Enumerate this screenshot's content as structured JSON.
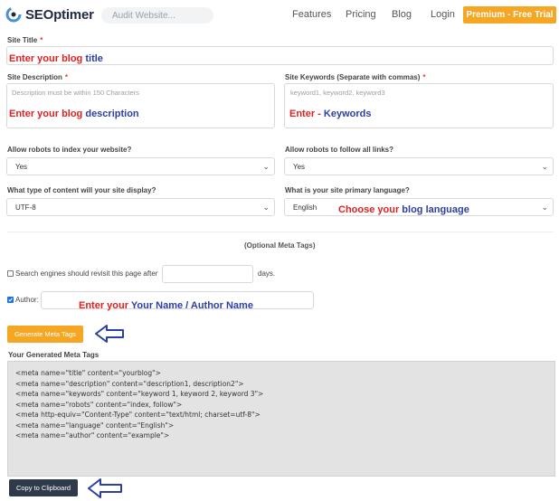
{
  "header": {
    "logo_text": "SEOptimer",
    "search_placeholder": "Audit Website...",
    "nav": [
      "Features",
      "Pricing",
      "Blog",
      "Login"
    ],
    "premium_label": "Premium - Free Trial"
  },
  "form": {
    "site_title": {
      "label": "Site Title",
      "required": "*",
      "overlay": {
        "red": "Enter your blog ",
        "blue": "title"
      }
    },
    "site_description": {
      "label": "Site Description",
      "required": "*",
      "placeholder": "Description must be within 150 Characters",
      "overlay": {
        "red": "Enter your blog ",
        "blue": "description"
      }
    },
    "site_keywords": {
      "label": "Site Keywords (Separate with commas)",
      "required": "*",
      "placeholder": "keyword1, keyword2, keyword3",
      "overlay": {
        "red": "Enter - ",
        "blue": "Keywords"
      }
    },
    "robots_index": {
      "label": "Allow robots to index your website?",
      "value": "Yes"
    },
    "robots_follow": {
      "label": "Allow robots to follow all links?",
      "value": "Yes"
    },
    "content_type": {
      "label": "What type of content will your site display?",
      "value": "UTF-8"
    },
    "language": {
      "label": "What is your site primary language?",
      "value": "English",
      "overlay": {
        "red": "Choose your ",
        "blue": "blog language"
      }
    },
    "optional_heading": "(Optional Meta Tags)",
    "revisit": {
      "checked": false,
      "label": "Search engines should revisit this page after",
      "suffix": "days."
    },
    "author": {
      "checked": true,
      "label": "Author:",
      "overlay": {
        "red": "Enter your  ",
        "blue": "Your Name / Author Name"
      }
    },
    "generate_label": "Generate Meta Tags"
  },
  "output": {
    "label": "Your Generated Meta Tags",
    "lines": [
      "<meta name=\"title\" content=\"yourblog\">",
      "<meta name=\"description\" content=\"description1, description2\">",
      "<meta name=\"keywords\" content=\"keyword 1, keyword 2, keyword 3\">",
      "<meta name=\"robots\" content=\"index, follow\">",
      "<meta http-equiv=\"Content-Type\" content=\"text/html; charset=utf-8\">",
      "<meta name=\"language\" content=\"English\">",
      "<meta name=\"author\" content=\"example\">"
    ],
    "copy_label": "Copy to Clipboard"
  },
  "colors": {
    "accent_orange": "#f5a623",
    "overlay_red": "#e02020",
    "overlay_blue": "#2b3fa6",
    "arrow_blue": "#2b3fa6",
    "copy_button": "#2f3a4a"
  },
  "icons": [
    "seoptimer-logo-icon",
    "arrow-left-icon",
    "chevron-down-icon"
  ]
}
